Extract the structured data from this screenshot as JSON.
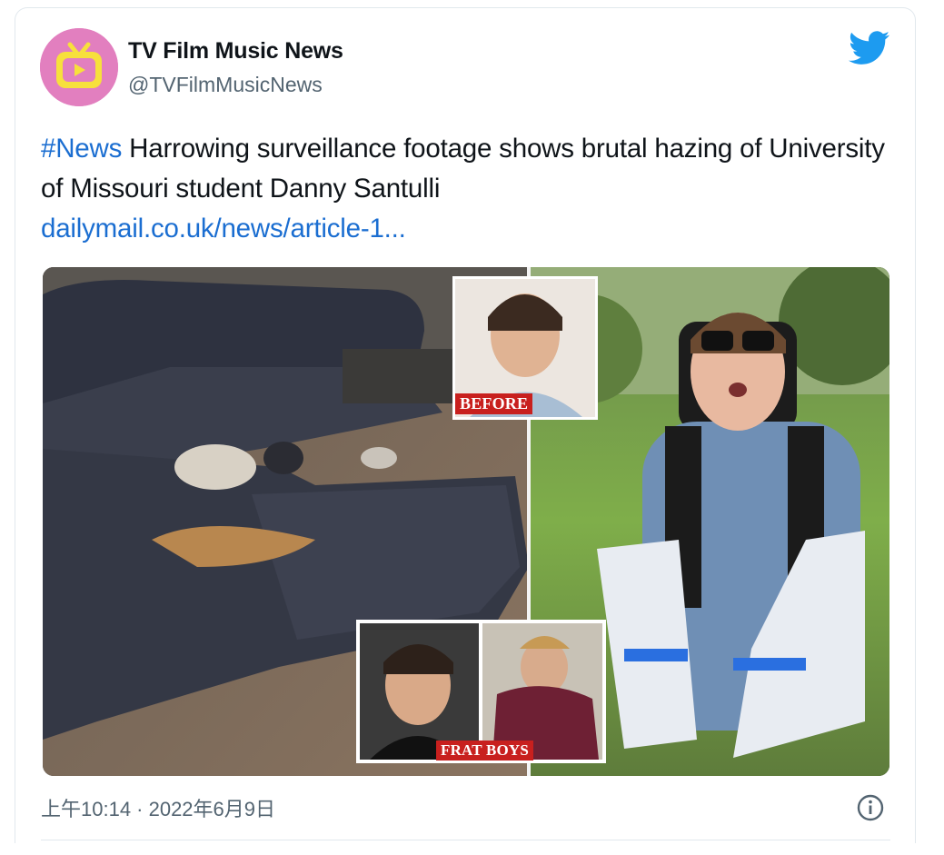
{
  "account": {
    "name": "TV Film Music News",
    "handle": "@TVFilmMusicNews"
  },
  "tweet": {
    "hashtag": "#News",
    "text": " Harrowing surveillance footage shows brutal hazing of University of Missouri student Danny Santulli",
    "link": "dailymail.co.uk/news/article-1..."
  },
  "media": {
    "label_before": "BEFORE",
    "label_frat": "FRAT BOYS"
  },
  "footer": {
    "timestamp": "上午10:14 · 2022年6月9日"
  },
  "icons": {
    "brand": "twitter-bird-icon",
    "info": "info-icon",
    "avatar": "tv-logo-icon"
  },
  "colors": {
    "accent": "#1d9bf0",
    "link": "#1b6ed1",
    "avatar_bg": "#e27fbf",
    "label_red": "#c8201e"
  }
}
